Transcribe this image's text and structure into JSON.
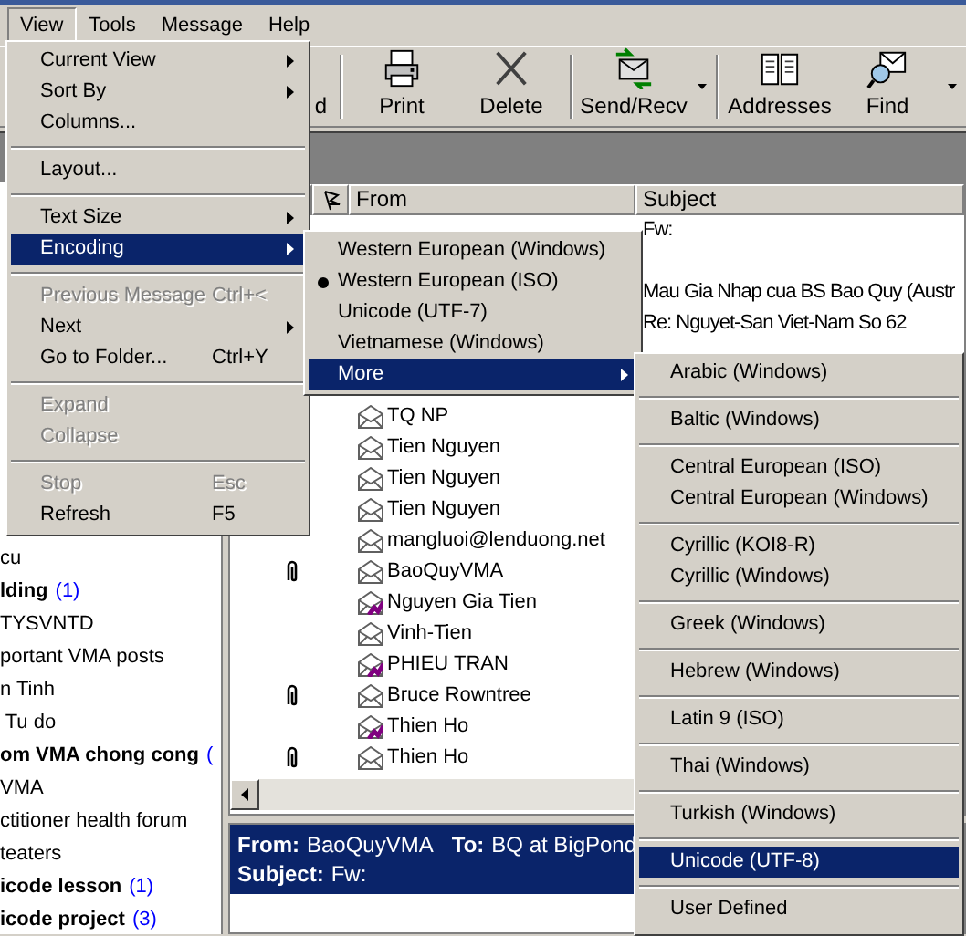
{
  "menu_bar": [
    {
      "label": "View",
      "selected": true
    },
    {
      "label": "Tools",
      "selected": false
    },
    {
      "label": "Message",
      "selected": false
    },
    {
      "label": "Help",
      "selected": false
    }
  ],
  "toolbar": [
    {
      "kind": "covered",
      "label": "d"
    },
    {
      "kind": "separator"
    },
    {
      "kind": "print",
      "label": "Print"
    },
    {
      "kind": "delete",
      "label": "Delete"
    },
    {
      "kind": "separator"
    },
    {
      "kind": "send_receive",
      "label": "Send/Recv",
      "dropdown": true
    },
    {
      "kind": "separator"
    },
    {
      "kind": "addresses",
      "label": "Addresses"
    },
    {
      "kind": "find",
      "label": "Find",
      "dropdown": true
    }
  ],
  "folders": [
    {
      "label": "cu",
      "unread": false
    },
    {
      "label": "lding",
      "count": "(1)",
      "unread": true
    },
    {
      "label": "TYSVNTD",
      "unread": false
    },
    {
      "label": "portant VMA posts",
      "unread": false
    },
    {
      "label": "n Tinh",
      "unread": false
    },
    {
      "label": " Tu do",
      "unread": false
    },
    {
      "label": "om VMA chong cong",
      "count": "(",
      "unread": true
    },
    {
      "label": "VMA",
      "unread": false
    },
    {
      "label": "ctitioner health forum",
      "unread": false
    },
    {
      "label": "teaters",
      "unread": false
    },
    {
      "label": "icode lesson",
      "count": "(1)",
      "unread": true
    },
    {
      "label": "icode project",
      "count": "(3)",
      "unread": true
    }
  ],
  "message_list": {
    "columns": [
      {
        "kind": "flag"
      },
      {
        "kind": "text",
        "label": "From"
      },
      {
        "kind": "text",
        "label": "Subject"
      }
    ],
    "rows": [
      {
        "kind": "covered",
        "subject": "Fw:"
      },
      {
        "kind": "covered"
      },
      {
        "kind": "covered",
        "subject": "Mau Gia Nhap cua BS Bao Quy (Austr"
      },
      {
        "kind": "covered",
        "subject": "Re: Nguyet-San Viet-Nam So 62"
      },
      {
        "kind": "covered"
      },
      {
        "kind": "covered"
      },
      {
        "kind": "read",
        "from": "TQ NP"
      },
      {
        "kind": "read",
        "from": "Tien Nguyen"
      },
      {
        "kind": "read",
        "from": "Tien Nguyen"
      },
      {
        "kind": "read",
        "from": "Tien Nguyen"
      },
      {
        "kind": "read",
        "from": "mangluoi@lenduong.net",
        "attachment": false
      },
      {
        "kind": "read",
        "from": "BaoQuyVMA",
        "attachment": true
      },
      {
        "kind": "forwarded",
        "from": "Nguyen Gia Tien",
        "attachment": false
      },
      {
        "kind": "read",
        "from": "Vinh-Tien",
        "attachment": false
      },
      {
        "kind": "forwarded",
        "from": "PHIEU TRAN",
        "attachment": false
      },
      {
        "kind": "read",
        "from": "Bruce Rowntree",
        "attachment": true
      },
      {
        "kind": "forwarded",
        "from": "Thien Ho",
        "attachment": false
      },
      {
        "kind": "read",
        "from": "Thien Ho",
        "attachment": true
      }
    ]
  },
  "preview": {
    "from_label": "From:",
    "from": "BaoQuyVMA",
    "to_label": "To:",
    "to": "BQ at BigPond",
    "subject_label": "Subject:",
    "subject": "Fw:"
  },
  "view_menu": [
    {
      "kind": "item",
      "label": "Current View",
      "submenu": true,
      "disabled": false,
      "selected": false
    },
    {
      "kind": "item",
      "label": "Sort By",
      "submenu": true,
      "disabled": false,
      "selected": false
    },
    {
      "kind": "item",
      "label": "Columns...",
      "submenu": false,
      "disabled": false,
      "selected": false
    },
    {
      "kind": "separator"
    },
    {
      "kind": "item",
      "label": "Layout...",
      "submenu": false,
      "disabled": false,
      "selected": false
    },
    {
      "kind": "separator"
    },
    {
      "kind": "item",
      "label": "Text Size",
      "submenu": true,
      "disabled": false,
      "selected": false
    },
    {
      "kind": "item",
      "label": "Encoding",
      "submenu": true,
      "disabled": false,
      "selected": true
    },
    {
      "kind": "separator"
    },
    {
      "kind": "item",
      "label": "Previous Message",
      "shortcut": "Ctrl+<",
      "submenu": false,
      "disabled": true,
      "selected": false
    },
    {
      "kind": "item",
      "label": "Next",
      "submenu": true,
      "disabled": false,
      "selected": false
    },
    {
      "kind": "item",
      "label": "Go to Folder...",
      "shortcut": "Ctrl+Y",
      "submenu": false,
      "disabled": false,
      "selected": false
    },
    {
      "kind": "separator"
    },
    {
      "kind": "item",
      "label": "Expand",
      "submenu": false,
      "disabled": true,
      "selected": false
    },
    {
      "kind": "item",
      "label": "Collapse",
      "submenu": false,
      "disabled": true,
      "selected": false
    },
    {
      "kind": "separator"
    },
    {
      "kind": "item",
      "label": "Stop",
      "shortcut": "Esc",
      "submenu": false,
      "disabled": true,
      "selected": false
    },
    {
      "kind": "item",
      "label": "Refresh",
      "shortcut": "F5",
      "submenu": false,
      "disabled": false,
      "selected": false
    }
  ],
  "encoding_menu": [
    {
      "label": "Western European (Windows)",
      "checked": false,
      "submenu": false,
      "selected": false
    },
    {
      "label": "Western European (ISO)",
      "checked": true,
      "submenu": false,
      "selected": false
    },
    {
      "label": "Unicode (UTF-7)",
      "checked": false,
      "submenu": false,
      "selected": false
    },
    {
      "label": "Vietnamese (Windows)",
      "checked": false,
      "submenu": false,
      "selected": false
    },
    {
      "label": "More",
      "checked": false,
      "submenu": true,
      "selected": true
    }
  ],
  "more_menu": [
    {
      "kind": "item",
      "label": "Arabic (Windows)",
      "selected": false
    },
    {
      "kind": "separator"
    },
    {
      "kind": "item",
      "label": "Baltic (Windows)",
      "selected": false
    },
    {
      "kind": "separator"
    },
    {
      "kind": "item",
      "label": "Central European (ISO)",
      "selected": false
    },
    {
      "kind": "item",
      "label": "Central European (Windows)",
      "selected": false
    },
    {
      "kind": "separator"
    },
    {
      "kind": "item",
      "label": "Cyrillic (KOI8-R)",
      "selected": false
    },
    {
      "kind": "item",
      "label": "Cyrillic (Windows)",
      "selected": false
    },
    {
      "kind": "separator"
    },
    {
      "kind": "item",
      "label": "Greek (Windows)",
      "selected": false
    },
    {
      "kind": "separator"
    },
    {
      "kind": "item",
      "label": "Hebrew (Windows)",
      "selected": false
    },
    {
      "kind": "separator"
    },
    {
      "kind": "item",
      "label": "Latin 9 (ISO)",
      "selected": false
    },
    {
      "kind": "separator"
    },
    {
      "kind": "item",
      "label": "Thai (Windows)",
      "selected": false
    },
    {
      "kind": "separator"
    },
    {
      "kind": "item",
      "label": "Turkish (Windows)",
      "selected": false
    },
    {
      "kind": "separator"
    },
    {
      "kind": "item",
      "label": "Unicode (UTF-8)",
      "selected": true
    },
    {
      "kind": "separator"
    },
    {
      "kind": "item",
      "label": "User Defined",
      "selected": false
    }
  ]
}
